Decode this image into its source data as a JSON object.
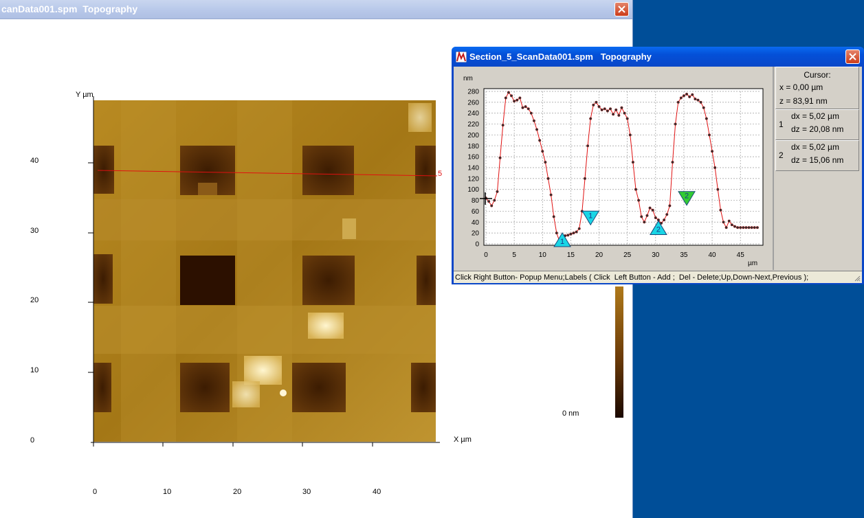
{
  "main_window": {
    "title": "canData001.spm  Topography",
    "image": {
      "y_axis_label": "Y µm",
      "x_axis_label": "X µm",
      "y_ticks": [
        "40",
        "30",
        "20",
        "10",
        "0"
      ],
      "x_ticks": [
        "0",
        "10",
        "20",
        "30",
        "40"
      ],
      "section_line_label": "5"
    },
    "colorbar_min_label": "0 nm"
  },
  "section_window": {
    "title": "Section_5_ScanData001.spm   Topography",
    "cursor": {
      "heading": "Cursor:",
      "x": "x = 0,00 µm",
      "z": "z = 83,91  nm"
    },
    "measurements": [
      {
        "index": "1",
        "dx": "dx = 5,02 µm",
        "dz": "dz = 20,08  nm"
      },
      {
        "index": "2",
        "dx": "dx = 5,02 µm",
        "dz": "dz = 15,06  nm"
      }
    ],
    "status_bar": "Click Right Button- Popup Menu;Labels ( Click  Left Button - Add ;  Del - Delete;Up,Down-Next,Previous );"
  },
  "chart_data": {
    "type": "line",
    "ylabel": "nm",
    "xlabel": "µm",
    "xlim": [
      0,
      48.5
    ],
    "ylim": [
      0,
      280
    ],
    "x_ticks": [
      "0",
      "5",
      "10",
      "15",
      "20",
      "25",
      "30",
      "35",
      "40",
      "45"
    ],
    "y_ticks": [
      "0",
      "20",
      "40",
      "60",
      "80",
      "100",
      "120",
      "140",
      "160",
      "180",
      "200",
      "220",
      "240",
      "260",
      "280"
    ],
    "grid": true,
    "line_color": "#e01010",
    "x": [
      0,
      0.5,
      1,
      1.5,
      2,
      2.5,
      3,
      3.5,
      4,
      4.5,
      5,
      5.5,
      6,
      6.5,
      7,
      7.5,
      8,
      8.5,
      9,
      9.5,
      10,
      10.5,
      11,
      11.5,
      12,
      12.5,
      13,
      13.5,
      14,
      14.5,
      15,
      15.5,
      16,
      16.5,
      17,
      17.5,
      18,
      18.5,
      19,
      19.5,
      20,
      20.5,
      21,
      21.5,
      22,
      22.5,
      23,
      23.5,
      24,
      24.5,
      25,
      25.5,
      26,
      26.5,
      27,
      27.5,
      28,
      28.5,
      29,
      29.5,
      30,
      30.5,
      31,
      31.5,
      32,
      32.5,
      33,
      33.5,
      34,
      34.5,
      35,
      35.5,
      36,
      36.5,
      37,
      37.5,
      38,
      38.5,
      39,
      39.5,
      40,
      40.5,
      41,
      41.5,
      42,
      42.5,
      43,
      43.5,
      44,
      44.5,
      45,
      45.5,
      46,
      46.5,
      47,
      47.5,
      48
    ],
    "y": [
      84,
      78,
      70,
      80,
      96,
      158,
      218,
      268,
      278,
      272,
      262,
      264,
      268,
      250,
      252,
      248,
      240,
      226,
      210,
      190,
      170,
      150,
      120,
      90,
      50,
      20,
      5,
      10,
      15,
      16,
      18,
      20,
      22,
      28,
      60,
      120,
      180,
      230,
      255,
      260,
      252,
      246,
      248,
      244,
      248,
      238,
      246,
      236,
      250,
      240,
      230,
      200,
      150,
      100,
      80,
      50,
      40,
      52,
      66,
      62,
      48,
      44,
      38,
      44,
      54,
      70,
      150,
      220,
      260,
      268,
      272,
      275,
      270,
      274,
      266,
      264,
      260,
      250,
      230,
      200,
      170,
      140,
      100,
      62,
      40,
      30,
      42,
      35,
      32,
      30,
      30,
      30,
      30,
      30,
      30,
      30,
      30
    ],
    "markers": [
      {
        "label": "1",
        "x": 13.5,
        "y": 0,
        "direction": "up",
        "color": "#19d6e6"
      },
      {
        "label": "1",
        "x": 18.5,
        "y": 40,
        "direction": "down",
        "color": "#19d6e6"
      },
      {
        "label": "2",
        "x": 30.5,
        "y": 22,
        "direction": "up",
        "color": "#19d6e6"
      },
      {
        "label": "2",
        "x": 35.5,
        "y": 76,
        "direction": "down",
        "color": "#33cc33"
      }
    ]
  }
}
